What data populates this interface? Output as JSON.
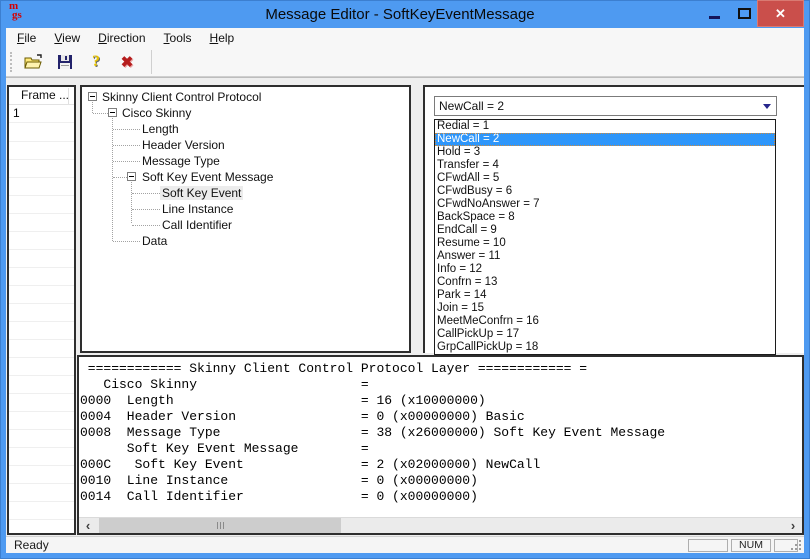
{
  "window": {
    "title": "Message Editor - SoftKeyEventMessage",
    "icon_top": "m",
    "icon_bottom": "gs"
  },
  "titlebar": {
    "close_glyph": "✕"
  },
  "menu": {
    "items": [
      "File",
      "View",
      "Direction",
      "Tools",
      "Help"
    ]
  },
  "toolbar": {
    "buttons": [
      {
        "name": "open-file",
        "icon": "folder-open-icon"
      },
      {
        "name": "save",
        "icon": "save-icon"
      },
      {
        "name": "help",
        "icon": "help-icon",
        "glyph": "?"
      },
      {
        "name": "delete",
        "icon": "delete-icon",
        "glyph": "✖"
      }
    ]
  },
  "frame_list": {
    "header": "Frame ...",
    "rows": [
      "1"
    ]
  },
  "tree": {
    "items": [
      {
        "label": "Skinny Client Control Protocol"
      },
      {
        "label": "Cisco Skinny"
      },
      {
        "label": "Length"
      },
      {
        "label": "Header Version"
      },
      {
        "label": "Message Type"
      },
      {
        "label": "Soft Key Event Message"
      },
      {
        "label": "Soft Key Event",
        "selected": true
      },
      {
        "label": "Line Instance"
      },
      {
        "label": "Call Identifier"
      },
      {
        "label": "Data"
      }
    ]
  },
  "combo": {
    "value": "NewCall = 2"
  },
  "dropdown": {
    "selected": "NewCall = 2",
    "options": [
      "Redial = 1",
      "NewCall = 2",
      "Hold = 3",
      "Transfer = 4",
      "CFwdAll = 5",
      "CFwdBusy = 6",
      "CFwdNoAnswer = 7",
      "BackSpace = 8",
      "EndCall = 9",
      "Resume = 10",
      "Answer = 11",
      "Info = 12",
      "Confrn = 13",
      "Park = 14",
      "Join = 15",
      "MeetMeConfrn = 16",
      "CallPickUp = 17",
      "GrpCallPickUp = 18"
    ]
  },
  "decode": {
    "lines": [
      " ============ Skinny Client Control Protocol Layer ============ =",
      "   Cisco Skinny                     =",
      "0000  Length                        = 16 (x10000000)",
      "0004  Header Version                = 0 (x00000000) Basic",
      "0008  Message Type                  = 38 (x26000000) Soft Key Event Message",
      "      Soft Key Event Message        =",
      "000C   Soft Key Event               = 2 (x02000000) NewCall",
      "0010  Line Instance                 = 0 (x00000000)",
      "0014  Call Identifier               = 0 (x00000000)"
    ]
  },
  "statusbar": {
    "message": "Ready",
    "num_indicator": "NUM"
  },
  "colors": {
    "titlebar": "#4e9af1",
    "selection_blue": "#2e96fa",
    "close_button": "#ca4f4b",
    "focus_dotted": "#cf8b3e"
  }
}
